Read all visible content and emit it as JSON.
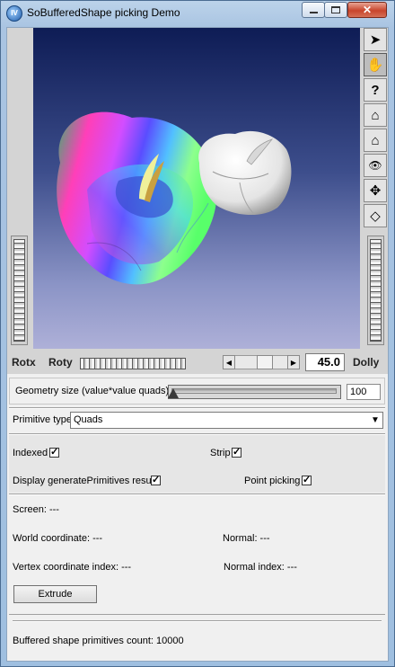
{
  "window": {
    "title": "SoBufferedShape picking Demo",
    "icon_text": "IV"
  },
  "viewer": {
    "labels": {
      "rotx": "Rotx",
      "roty": "Roty",
      "dolly": "Dolly"
    },
    "dolly_value": "45.0",
    "tools": [
      "select-arrow-icon",
      "hand-icon",
      "help-icon",
      "home-icon",
      "set-home-icon",
      "view-all-icon",
      "seek-icon",
      "projection-icon"
    ],
    "tool_glyphs": [
      "➤",
      "✋",
      "?",
      "⌂",
      "⌂",
      "👁",
      "✥",
      "◇"
    ]
  },
  "geometry": {
    "label": "Geometry size (value*value quads):",
    "value": "100",
    "slider_fraction": 0.0
  },
  "primitive": {
    "label": "Primitive type",
    "selected": "Quads"
  },
  "options": {
    "indexed_label": "Indexed",
    "indexed_checked": true,
    "strip_label": "Strip",
    "strip_checked": true,
    "display_label": "Display generatePrimitives result",
    "display_checked": true,
    "point_picking_label": "Point picking",
    "point_picking_checked": true,
    "check_glyph": "✓"
  },
  "info": {
    "screen": "Screen: ---",
    "world": "World coordinate: ---",
    "normal": "Normal: ---",
    "vertex_index": "Vertex coordinate index: ---",
    "normal_index": "Normal index: ---"
  },
  "extrude_label": "Extrude",
  "status": "Buffered shape primitives count: 10000"
}
